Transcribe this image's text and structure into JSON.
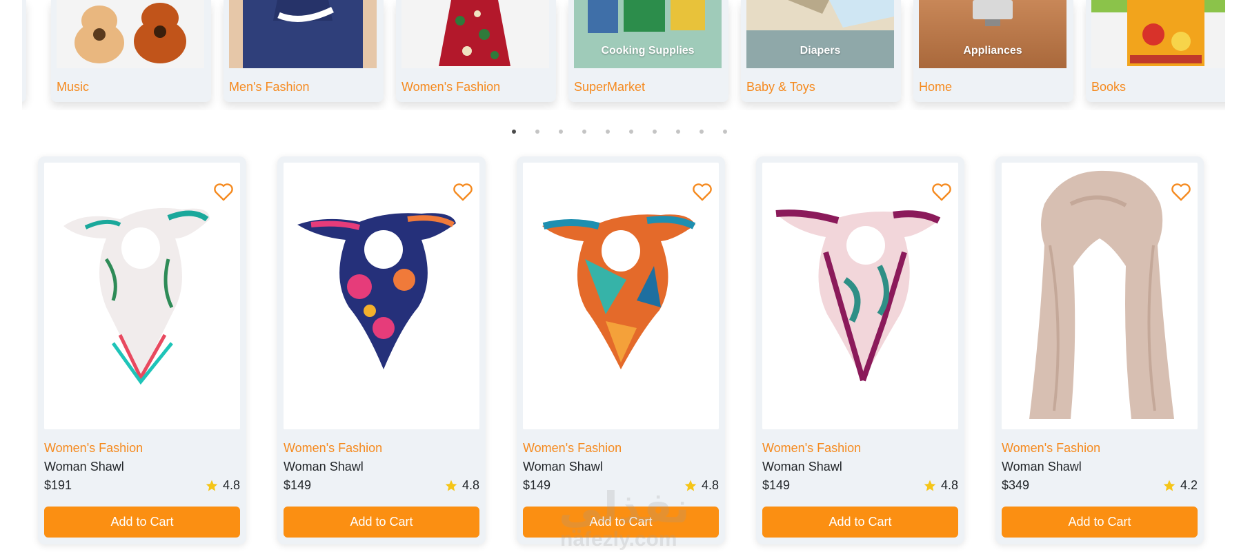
{
  "categories": [
    {
      "label": "Music",
      "image": "guitars",
      "caption": ""
    },
    {
      "label": "Men's Fashion",
      "image": "blue-hoodie",
      "caption": ""
    },
    {
      "label": "Women's Fashion",
      "image": "floral-dress",
      "caption": ""
    },
    {
      "label": "SuperMarket",
      "image": "groceries",
      "caption": "Cooking Supplies"
    },
    {
      "label": "Baby & Toys",
      "image": "diapers",
      "caption": "Diapers"
    },
    {
      "label": "Home",
      "image": "coffee-machine",
      "caption": "Appliances"
    },
    {
      "label": "Books",
      "image": "book-cover",
      "caption": ""
    }
  ],
  "slider": {
    "dot_count": 10,
    "active_index": 0
  },
  "products": [
    {
      "category": "Women's Fashion",
      "title": "Woman Shawl",
      "price": "$191",
      "rating": "4.8",
      "button": "Add to Cart",
      "image": "white-green-scarf"
    },
    {
      "category": "Women's Fashion",
      "title": "Woman Shawl",
      "price": "$149",
      "rating": "4.8",
      "button": "Add to Cart",
      "image": "navy-pink-scarf"
    },
    {
      "category": "Women's Fashion",
      "title": "Woman Shawl",
      "price": "$149",
      "rating": "4.8",
      "button": "Add to Cart",
      "image": "teal-orange-scarf"
    },
    {
      "category": "Women's Fashion",
      "title": "Woman Shawl",
      "price": "$149",
      "rating": "4.8",
      "button": "Add to Cart",
      "image": "burgundy-scarf"
    },
    {
      "category": "Women's Fashion",
      "title": "Woman Shawl",
      "price": "$349",
      "rating": "4.2",
      "button": "Add to Cart",
      "image": "beige-long-scarf"
    }
  ],
  "watermark": {
    "arabic": "نفذلي",
    "latin": "nafezly.com"
  },
  "colors": {
    "accent": "#fb8f12",
    "label_orange": "#f58a1f",
    "star": "#f5c518",
    "card_bg": "#eef2f6"
  },
  "icons": {
    "favorite": "heart-outline-icon",
    "rating": "star-icon"
  }
}
